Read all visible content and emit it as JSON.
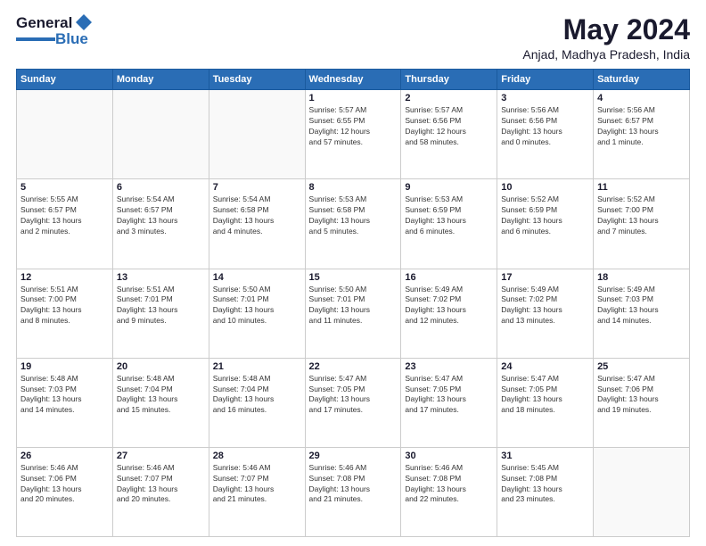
{
  "header": {
    "logo_line1": "General",
    "logo_line2": "Blue",
    "title": "May 2024",
    "location": "Anjad, Madhya Pradesh, India"
  },
  "days_of_week": [
    "Sunday",
    "Monday",
    "Tuesday",
    "Wednesday",
    "Thursday",
    "Friday",
    "Saturday"
  ],
  "weeks": [
    [
      {
        "day": "",
        "content": ""
      },
      {
        "day": "",
        "content": ""
      },
      {
        "day": "",
        "content": ""
      },
      {
        "day": "1",
        "content": "Sunrise: 5:57 AM\nSunset: 6:55 PM\nDaylight: 12 hours\nand 57 minutes."
      },
      {
        "day": "2",
        "content": "Sunrise: 5:57 AM\nSunset: 6:56 PM\nDaylight: 12 hours\nand 58 minutes."
      },
      {
        "day": "3",
        "content": "Sunrise: 5:56 AM\nSunset: 6:56 PM\nDaylight: 13 hours\nand 0 minutes."
      },
      {
        "day": "4",
        "content": "Sunrise: 5:56 AM\nSunset: 6:57 PM\nDaylight: 13 hours\nand 1 minute."
      }
    ],
    [
      {
        "day": "5",
        "content": "Sunrise: 5:55 AM\nSunset: 6:57 PM\nDaylight: 13 hours\nand 2 minutes."
      },
      {
        "day": "6",
        "content": "Sunrise: 5:54 AM\nSunset: 6:57 PM\nDaylight: 13 hours\nand 3 minutes."
      },
      {
        "day": "7",
        "content": "Sunrise: 5:54 AM\nSunset: 6:58 PM\nDaylight: 13 hours\nand 4 minutes."
      },
      {
        "day": "8",
        "content": "Sunrise: 5:53 AM\nSunset: 6:58 PM\nDaylight: 13 hours\nand 5 minutes."
      },
      {
        "day": "9",
        "content": "Sunrise: 5:53 AM\nSunset: 6:59 PM\nDaylight: 13 hours\nand 6 minutes."
      },
      {
        "day": "10",
        "content": "Sunrise: 5:52 AM\nSunset: 6:59 PM\nDaylight: 13 hours\nand 6 minutes."
      },
      {
        "day": "11",
        "content": "Sunrise: 5:52 AM\nSunset: 7:00 PM\nDaylight: 13 hours\nand 7 minutes."
      }
    ],
    [
      {
        "day": "12",
        "content": "Sunrise: 5:51 AM\nSunset: 7:00 PM\nDaylight: 13 hours\nand 8 minutes."
      },
      {
        "day": "13",
        "content": "Sunrise: 5:51 AM\nSunset: 7:01 PM\nDaylight: 13 hours\nand 9 minutes."
      },
      {
        "day": "14",
        "content": "Sunrise: 5:50 AM\nSunset: 7:01 PM\nDaylight: 13 hours\nand 10 minutes."
      },
      {
        "day": "15",
        "content": "Sunrise: 5:50 AM\nSunset: 7:01 PM\nDaylight: 13 hours\nand 11 minutes."
      },
      {
        "day": "16",
        "content": "Sunrise: 5:49 AM\nSunset: 7:02 PM\nDaylight: 13 hours\nand 12 minutes."
      },
      {
        "day": "17",
        "content": "Sunrise: 5:49 AM\nSunset: 7:02 PM\nDaylight: 13 hours\nand 13 minutes."
      },
      {
        "day": "18",
        "content": "Sunrise: 5:49 AM\nSunset: 7:03 PM\nDaylight: 13 hours\nand 14 minutes."
      }
    ],
    [
      {
        "day": "19",
        "content": "Sunrise: 5:48 AM\nSunset: 7:03 PM\nDaylight: 13 hours\nand 14 minutes."
      },
      {
        "day": "20",
        "content": "Sunrise: 5:48 AM\nSunset: 7:04 PM\nDaylight: 13 hours\nand 15 minutes."
      },
      {
        "day": "21",
        "content": "Sunrise: 5:48 AM\nSunset: 7:04 PM\nDaylight: 13 hours\nand 16 minutes."
      },
      {
        "day": "22",
        "content": "Sunrise: 5:47 AM\nSunset: 7:05 PM\nDaylight: 13 hours\nand 17 minutes."
      },
      {
        "day": "23",
        "content": "Sunrise: 5:47 AM\nSunset: 7:05 PM\nDaylight: 13 hours\nand 17 minutes."
      },
      {
        "day": "24",
        "content": "Sunrise: 5:47 AM\nSunset: 7:05 PM\nDaylight: 13 hours\nand 18 minutes."
      },
      {
        "day": "25",
        "content": "Sunrise: 5:47 AM\nSunset: 7:06 PM\nDaylight: 13 hours\nand 19 minutes."
      }
    ],
    [
      {
        "day": "26",
        "content": "Sunrise: 5:46 AM\nSunset: 7:06 PM\nDaylight: 13 hours\nand 20 minutes."
      },
      {
        "day": "27",
        "content": "Sunrise: 5:46 AM\nSunset: 7:07 PM\nDaylight: 13 hours\nand 20 minutes."
      },
      {
        "day": "28",
        "content": "Sunrise: 5:46 AM\nSunset: 7:07 PM\nDaylight: 13 hours\nand 21 minutes."
      },
      {
        "day": "29",
        "content": "Sunrise: 5:46 AM\nSunset: 7:08 PM\nDaylight: 13 hours\nand 21 minutes."
      },
      {
        "day": "30",
        "content": "Sunrise: 5:46 AM\nSunset: 7:08 PM\nDaylight: 13 hours\nand 22 minutes."
      },
      {
        "day": "31",
        "content": "Sunrise: 5:45 AM\nSunset: 7:08 PM\nDaylight: 13 hours\nand 23 minutes."
      },
      {
        "day": "",
        "content": ""
      }
    ]
  ]
}
